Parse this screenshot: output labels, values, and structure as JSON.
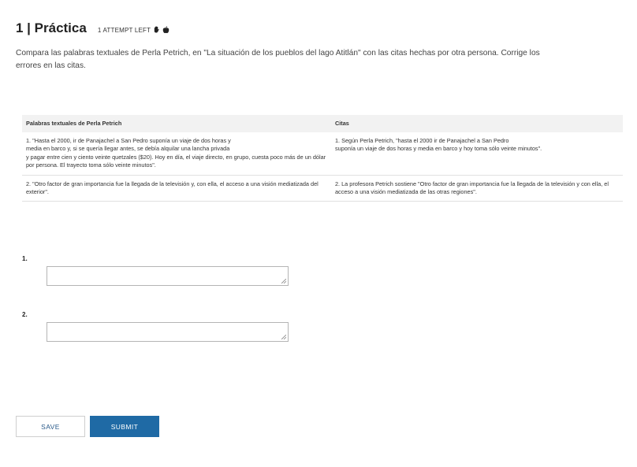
{
  "header": {
    "title": "1 | Práctica",
    "attempts": "1 ATTEMPT LEFT",
    "icons": [
      "hand-icon",
      "apple-icon"
    ]
  },
  "instructions": "Compara las palabras textuales de Perla Petrich, en \"La situación de los pueblos del lago Atitlán\" con las citas hechas por otra persona. Corrige los errores en las citas.",
  "table": {
    "headers": [
      "Palabras textuales de Perla Petrich",
      "Citas"
    ],
    "rows": [
      [
        "1. \"Hasta el 2000, ir de Panajachel a San Pedro suponía un viaje de dos horas y\nmedia en barco y, si se quería llegar antes, se debía alquilar una lancha privada\ny pagar entre cien y ciento veinte quetzales ($20). Hoy en día, el viaje directo, en grupo, cuesta poco más de un dólar por persona. El trayecto toma sólo veinte minutos\".",
        "1. Según Perla Petrich, \"hasta el 2000 ir de Panajachel a San Pedro\nsuponía un viaje de dos horas y media en barco y hoy toma sólo veinte minutos\"."
      ],
      [
        "2. \"Otro factor de gran importancia fue la llegada de la televisión y, con ella, el acceso a una visión mediatizada del exterior\".",
        "2. La profesora Petrich sostiene \"Otro factor de gran importancia fue la llegada de la televisión y con ella, el acceso a una visión mediatizada de las otras regiones\"."
      ]
    ]
  },
  "questions": [
    {
      "number": "1.",
      "value": ""
    },
    {
      "number": "2.",
      "value": ""
    }
  ],
  "buttons": {
    "save": "SAVE",
    "submit": "SUBMIT"
  }
}
